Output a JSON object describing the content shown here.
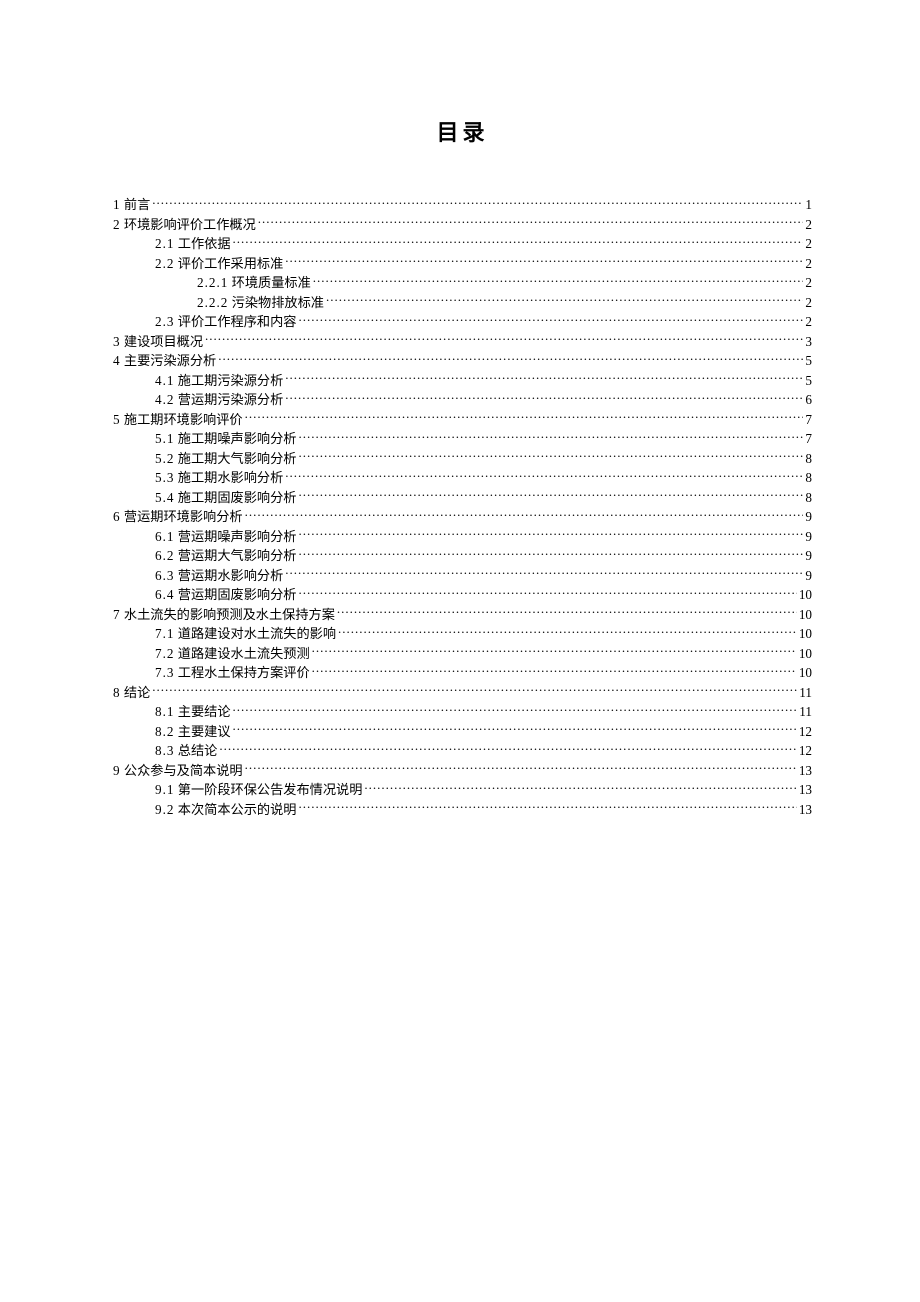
{
  "title": "目录",
  "toc": [
    {
      "level": 1,
      "num": "1",
      "label": "前言",
      "page": "1"
    },
    {
      "level": 1,
      "num": "2",
      "label": "环境影响评价工作概况",
      "page": "2"
    },
    {
      "level": 2,
      "num": "2.1",
      "label": "工作依据",
      "page": "2"
    },
    {
      "level": 2,
      "num": "2.2",
      "label": "评价工作采用标准",
      "page": "2"
    },
    {
      "level": 3,
      "num": "2.2.1",
      "label": "环境质量标准",
      "page": "2"
    },
    {
      "level": 3,
      "num": "2.2.2",
      "label": "污染物排放标准",
      "page": "2"
    },
    {
      "level": 2,
      "num": "2.3",
      "label": "评价工作程序和内容",
      "page": "2"
    },
    {
      "level": 1,
      "num": "3",
      "label": "建设项目概况",
      "page": "3"
    },
    {
      "level": 1,
      "num": "4",
      "label": "主要污染源分析",
      "page": "5"
    },
    {
      "level": 2,
      "num": "4.1",
      "label": "施工期污染源分析",
      "page": "5"
    },
    {
      "level": 2,
      "num": "4.2",
      "label": "营运期污染源分析",
      "page": "6"
    },
    {
      "level": 1,
      "num": "5",
      "label": "施工期环境影响评价",
      "page": "7"
    },
    {
      "level": 2,
      "num": "5.1",
      "label": "施工期噪声影响分析",
      "page": "7"
    },
    {
      "level": 2,
      "num": "5.2",
      "label": "施工期大气影响分析",
      "page": "8"
    },
    {
      "level": 2,
      "num": "5.3",
      "label": "施工期水影响分析",
      "page": "8"
    },
    {
      "level": 2,
      "num": "5.4",
      "label": "施工期固废影响分析",
      "page": "8"
    },
    {
      "level": 1,
      "num": "6",
      "label": "营运期环境影响分析",
      "page": "9"
    },
    {
      "level": 2,
      "num": "6.1",
      "label": "营运期噪声影响分析",
      "page": "9"
    },
    {
      "level": 2,
      "num": "6.2",
      "label": "营运期大气影响分析",
      "page": "9"
    },
    {
      "level": 2,
      "num": "6.3",
      "label": "营运期水影响分析",
      "page": "9"
    },
    {
      "level": 2,
      "num": "6.4",
      "label": "营运期固废影响分析",
      "page": "10"
    },
    {
      "level": 1,
      "num": "7",
      "label": "水土流失的影响预测及水土保持方案",
      "page": "10"
    },
    {
      "level": 2,
      "num": "7.1",
      "label": "道路建设对水土流失的影响",
      "page": "10"
    },
    {
      "level": 2,
      "num": "7.2",
      "label": "道路建设水土流失预测",
      "page": "10"
    },
    {
      "level": 2,
      "num": "7.3",
      "label": "工程水土保持方案评价",
      "page": "10"
    },
    {
      "level": 1,
      "num": "8",
      "label": "结论",
      "page": "11"
    },
    {
      "level": 2,
      "num": "8.1",
      "label": "主要结论",
      "page": "11"
    },
    {
      "level": 2,
      "num": "8.2",
      "label": "主要建议",
      "page": "12"
    },
    {
      "level": 2,
      "num": "8.3",
      "label": "总结论",
      "page": "12"
    },
    {
      "level": 1,
      "num": "9",
      "label": "公众参与及简本说明",
      "page": "13"
    },
    {
      "level": 2,
      "num": "9.1",
      "label": "第一阶段环保公告发布情况说明",
      "page": "13"
    },
    {
      "level": 2,
      "num": "9.2",
      "label": "本次简本公示的说明",
      "page": "13"
    }
  ]
}
